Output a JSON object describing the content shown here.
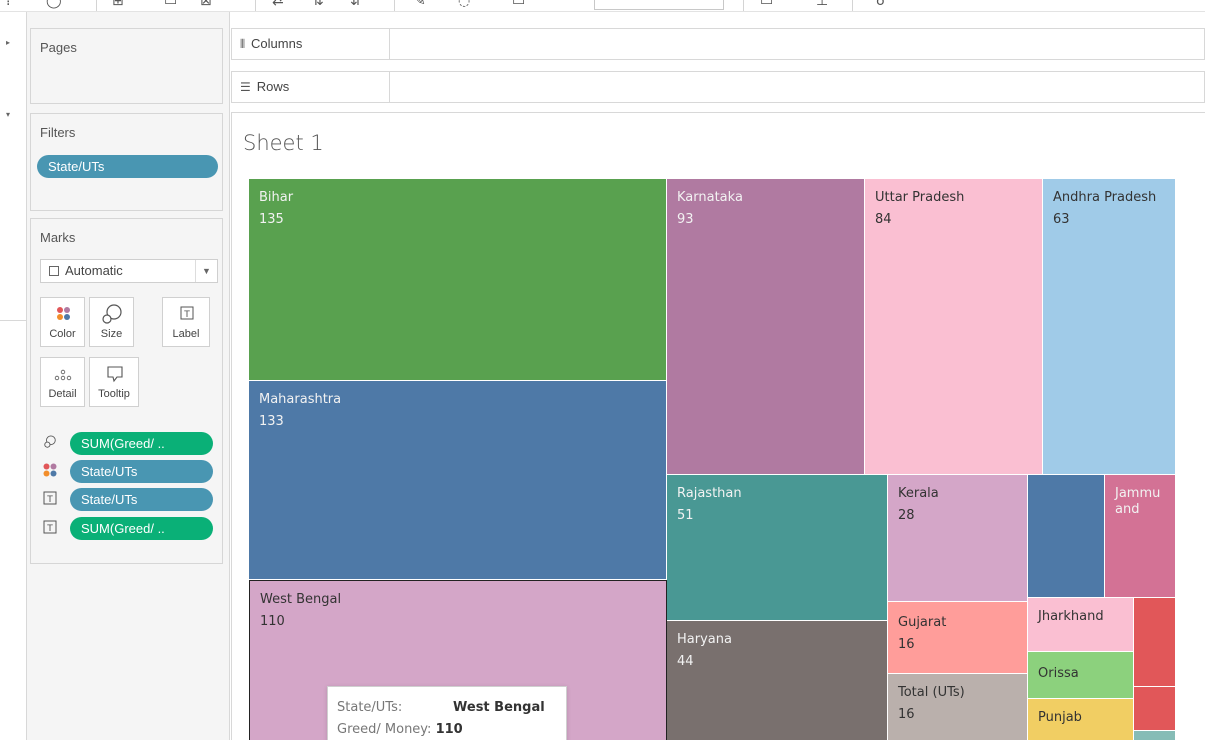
{
  "toolbar": {
    "icons": [
      "menu-icon",
      "undo-icon",
      "new-datasource-icon",
      "pause-icon",
      "clear-sheet-icon",
      "swap-icon",
      "sort-ascending-icon",
      "sort-descending-icon",
      "highlight-icon",
      "group-icon",
      "show-labels-icon",
      "fit-dropdown",
      "presentation-icon",
      "share-icon"
    ]
  },
  "shelves": {
    "pages": "Pages",
    "filters": "Filters",
    "marks": "Marks",
    "columns": "Columns",
    "rows": "Rows"
  },
  "filters": {
    "items": [
      "State/UTs"
    ]
  },
  "marks": {
    "mark_type": "Automatic",
    "buttons": {
      "color": "Color",
      "size": "Size",
      "label": "Label",
      "detail": "Detail",
      "tooltip": "Tooltip"
    },
    "fields": [
      {
        "icon": "size-icon",
        "label": "SUM(Greed/ ..",
        "color": "#0ab077"
      },
      {
        "icon": "color-icon",
        "label": "State/UTs",
        "color": "#4996b2"
      },
      {
        "icon": "label-icon",
        "label": "State/UTs",
        "color": "#4996b2"
      },
      {
        "icon": "label-icon",
        "label": "SUM(Greed/ ..",
        "color": "#0ab077"
      }
    ]
  },
  "sheet": {
    "title": "Sheet 1"
  },
  "treemap": {
    "cells": [
      {
        "name": "Bihar",
        "value": "135",
        "color": "#59a14f"
      },
      {
        "name": "Maharashtra",
        "value": "133",
        "color": "#4e79a7"
      },
      {
        "name": "West Bengal",
        "value": "110",
        "color": "#d4a6c8"
      },
      {
        "name": "Karnataka",
        "value": "93",
        "color": "#b07aa1"
      },
      {
        "name": "Uttar Pradesh",
        "value": "84",
        "color": "#fabfd2"
      },
      {
        "name": "Andhra Pradesh",
        "value": "63",
        "color": "#a0cbe8"
      },
      {
        "name": "Rajasthan",
        "value": "51",
        "color": "#499894"
      },
      {
        "name": "Haryana",
        "value": "44",
        "color": "#79706e"
      },
      {
        "name": "Kerala",
        "value": "28",
        "color": "#d4a6c8"
      },
      {
        "name": "",
        "value": "",
        "color": "#4e79a7"
      },
      {
        "name": "Jammu and",
        "value": "",
        "color": "#d37295"
      },
      {
        "name": "Gujarat",
        "value": "16",
        "color": "#ff9d9a"
      },
      {
        "name": "Total (UTs)",
        "value": "16",
        "color": "#bab0ac"
      },
      {
        "name": "Jharkhand",
        "value": "",
        "color": "#fabfd2"
      },
      {
        "name": "Orissa",
        "value": "",
        "color": "#8cd17d"
      },
      {
        "name": "Punjab",
        "value": "",
        "color": "#f1ce63"
      },
      {
        "name": "",
        "value": "",
        "color": "#e15759"
      },
      {
        "name": "",
        "value": "",
        "color": "#e15759"
      },
      {
        "name": "",
        "value": "",
        "color": "#86bcb6"
      }
    ]
  },
  "tooltip": {
    "state_key": "State/UTs:",
    "state_value": "West Bengal",
    "money_key": "Greed/ Money:",
    "money_value": "110"
  }
}
